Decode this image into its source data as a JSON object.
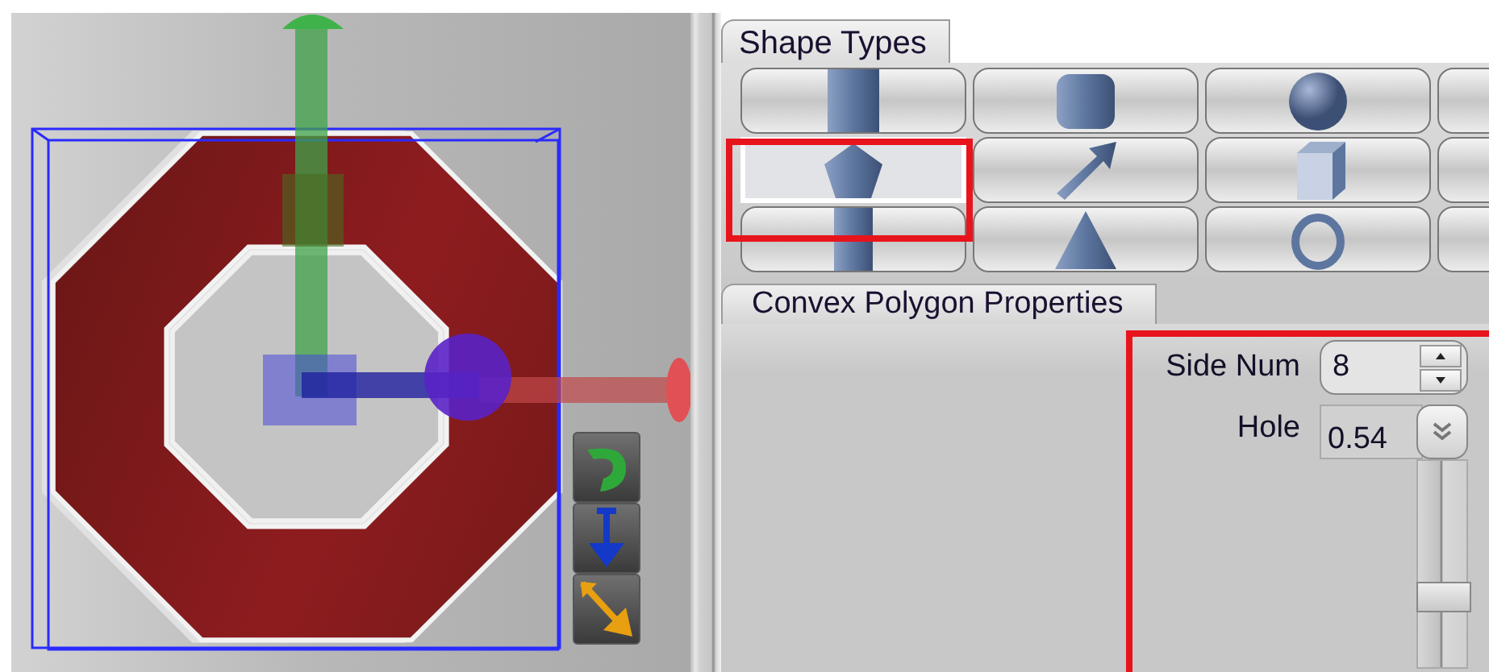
{
  "shape_types": {
    "title": "Shape Types",
    "buttons": [
      {
        "kind": "prism",
        "selected": false
      },
      {
        "kind": "rounded-box",
        "selected": false
      },
      {
        "kind": "sphere",
        "selected": false
      },
      {
        "kind": "partial",
        "selected": false
      },
      {
        "kind": "pentagon",
        "selected": true
      },
      {
        "kind": "arrow",
        "selected": false
      },
      {
        "kind": "cube",
        "selected": false
      },
      {
        "kind": "partial",
        "selected": false
      },
      {
        "kind": "cylinder",
        "selected": false
      },
      {
        "kind": "cone",
        "selected": false
      },
      {
        "kind": "torus",
        "selected": false
      },
      {
        "kind": "partial",
        "selected": false
      }
    ]
  },
  "properties": {
    "title": "Convex Polygon Properties",
    "side_num": {
      "label": "Side Num",
      "value": "8"
    },
    "hole": {
      "label": "Hole",
      "value": "0.54",
      "level": 0.34
    }
  }
}
